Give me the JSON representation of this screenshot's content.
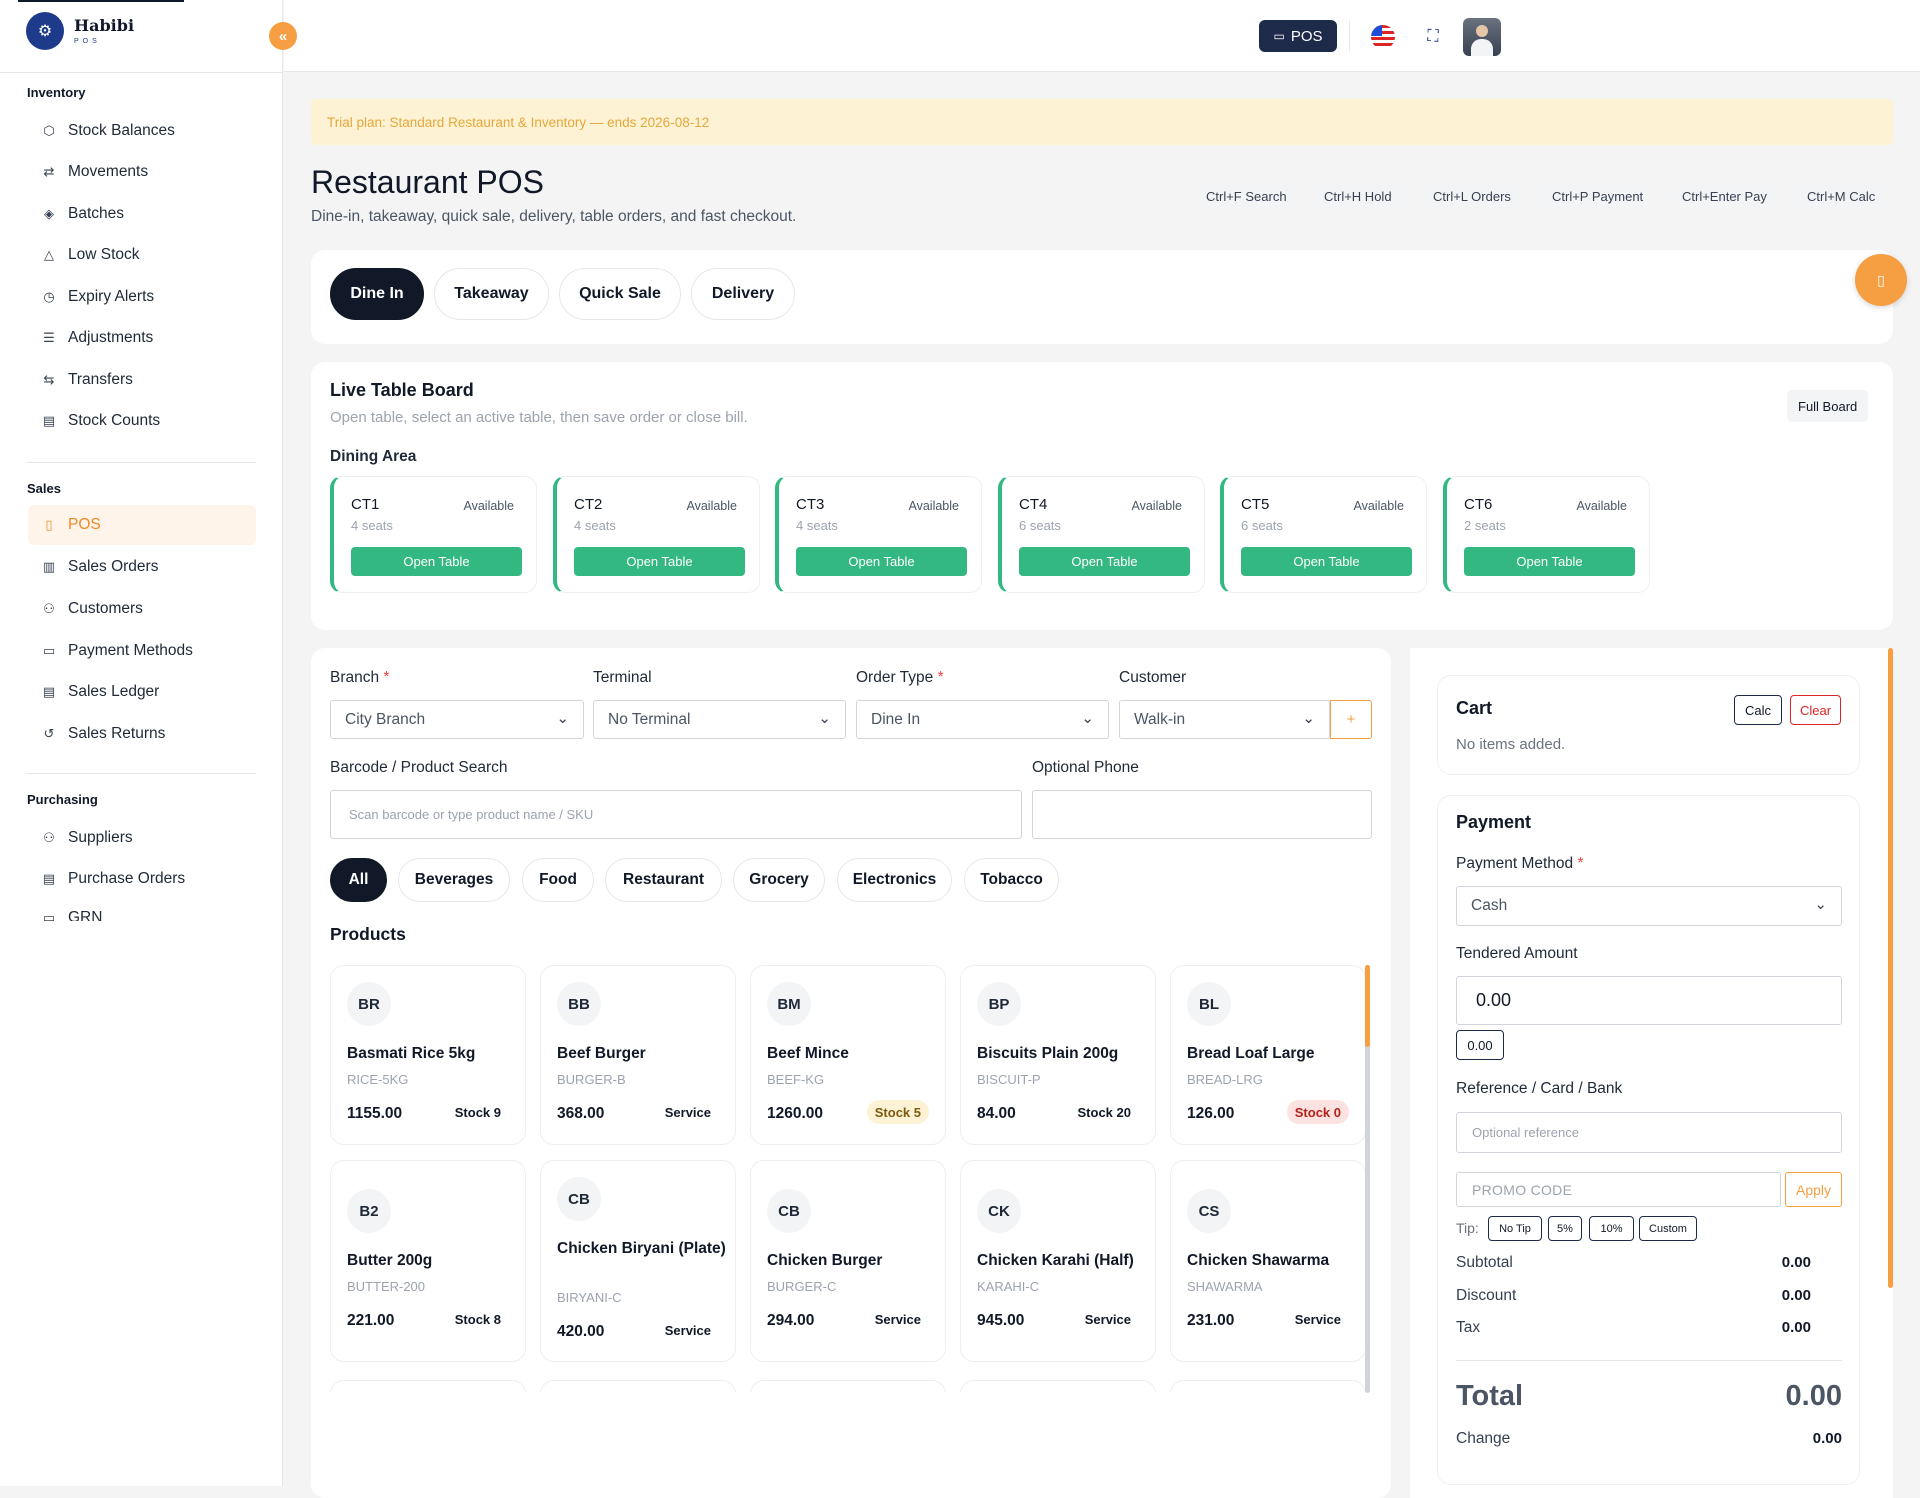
{
  "brand": {
    "name": "Habibi",
    "sub": "POS"
  },
  "sidebar": {
    "sections": [
      {
        "title": "Inventory",
        "items": [
          {
            "label": "Stock Balances",
            "icon": "cube-icon"
          },
          {
            "label": "Movements",
            "icon": "arrows-icon"
          },
          {
            "label": "Batches",
            "icon": "layers-icon"
          },
          {
            "label": "Low Stock",
            "icon": "warning-icon"
          },
          {
            "label": "Expiry Alerts",
            "icon": "clock-icon"
          },
          {
            "label": "Adjustments",
            "icon": "sliders-icon"
          },
          {
            "label": "Transfers",
            "icon": "transfer-icon"
          },
          {
            "label": "Stock Counts",
            "icon": "clipboard-icon"
          }
        ]
      },
      {
        "title": "Sales",
        "items": [
          {
            "label": "POS",
            "icon": "pos-icon",
            "active": true
          },
          {
            "label": "Sales Orders",
            "icon": "receipt-icon"
          },
          {
            "label": "Customers",
            "icon": "users-icon"
          },
          {
            "label": "Payment Methods",
            "icon": "card-icon"
          },
          {
            "label": "Sales Ledger",
            "icon": "ledger-icon"
          },
          {
            "label": "Sales Returns",
            "icon": "return-icon"
          }
        ]
      },
      {
        "title": "Purchasing",
        "items": [
          {
            "label": "Suppliers",
            "icon": "users-icon"
          },
          {
            "label": "Purchase Orders",
            "icon": "clipboard-icon"
          },
          {
            "label": "GRN",
            "icon": "doc-icon"
          }
        ]
      }
    ]
  },
  "topbar": {
    "pos_label": "POS"
  },
  "trial": "Trial plan: Standard Restaurant & Inventory — ends 2026-08-12",
  "page": {
    "title": "Restaurant POS",
    "subtitle": "Dine-in, takeaway, quick sale, delivery, table orders, and fast checkout."
  },
  "shortcuts": [
    "Ctrl+F Search",
    "Ctrl+H Hold",
    "Ctrl+L Orders",
    "Ctrl+P Payment",
    "Ctrl+Enter Pay",
    "Ctrl+M Calc"
  ],
  "order_tabs": [
    {
      "label": "Dine In",
      "selected": true
    },
    {
      "label": "Takeaway"
    },
    {
      "label": "Quick Sale"
    },
    {
      "label": "Delivery"
    }
  ],
  "table_board": {
    "title": "Live Table Board",
    "subtitle": "Open table, select an active table, then save order or close bill.",
    "full_board": "Full Board",
    "area": "Dining Area",
    "open_label": "Open Table",
    "tables": [
      {
        "name": "CT1",
        "seats": "4 seats",
        "status": "Available"
      },
      {
        "name": "CT2",
        "seats": "4 seats",
        "status": "Available"
      },
      {
        "name": "CT3",
        "seats": "4 seats",
        "status": "Available"
      },
      {
        "name": "CT4",
        "seats": "6 seats",
        "status": "Available"
      },
      {
        "name": "CT5",
        "seats": "6 seats",
        "status": "Available"
      },
      {
        "name": "CT6",
        "seats": "2 seats",
        "status": "Available"
      }
    ]
  },
  "form": {
    "branch_label": "Branch",
    "branch_value": "City Branch",
    "terminal_label": "Terminal",
    "terminal_value": "No Terminal",
    "ordertype_label": "Order Type",
    "ordertype_value": "Dine In",
    "customer_label": "Customer",
    "customer_value": "Walk-in",
    "add_label": "+",
    "search_label": "Barcode / Product Search",
    "search_placeholder": "Scan barcode or type product name / SKU",
    "phone_label": "Optional Phone",
    "phone_value": ""
  },
  "categories": [
    {
      "label": "All",
      "selected": true
    },
    {
      "label": "Beverages"
    },
    {
      "label": "Food"
    },
    {
      "label": "Restaurant"
    },
    {
      "label": "Grocery"
    },
    {
      "label": "Electronics"
    },
    {
      "label": "Tobacco"
    }
  ],
  "products_title": "Products",
  "products": [
    {
      "abbr": "BR",
      "name": "Basmati Rice 5kg",
      "sku": "RICE-5KG",
      "price": "1155.00",
      "stock": "Stock 9",
      "kind": "normal"
    },
    {
      "abbr": "BB",
      "name": "Beef Burger",
      "sku": "BURGER-B",
      "price": "368.00",
      "stock": "Service",
      "kind": "normal"
    },
    {
      "abbr": "BM",
      "name": "Beef Mince",
      "sku": "BEEF-KG",
      "price": "1260.00",
      "stock": "Stock 5",
      "kind": "warn"
    },
    {
      "abbr": "BP",
      "name": "Biscuits Plain 200g",
      "sku": "BISCUIT-P",
      "price": "84.00",
      "stock": "Stock 20",
      "kind": "normal"
    },
    {
      "abbr": "BL",
      "name": "Bread Loaf Large",
      "sku": "BREAD-LRG",
      "price": "126.00",
      "stock": "Stock 0",
      "kind": "zero"
    },
    {
      "abbr": "B2",
      "name": "Butter 200g",
      "sku": "BUTTER-200",
      "price": "221.00",
      "stock": "Stock 8",
      "kind": "normal"
    },
    {
      "abbr": "CB",
      "name": "Chicken Biryani (Plate)",
      "sku": "BIRYANI-C",
      "price": "420.00",
      "stock": "Service",
      "kind": "normal"
    },
    {
      "abbr": "CB",
      "name": "Chicken Burger",
      "sku": "BURGER-C",
      "price": "294.00",
      "stock": "Service",
      "kind": "normal"
    },
    {
      "abbr": "CK",
      "name": "Chicken Karahi (Half)",
      "sku": "KARAHI-C",
      "price": "945.00",
      "stock": "Service",
      "kind": "normal"
    },
    {
      "abbr": "CS",
      "name": "Chicken Shawarma",
      "sku": "SHAWARMA",
      "price": "231.00",
      "stock": "Service",
      "kind": "normal"
    }
  ],
  "cart": {
    "title": "Cart",
    "calc": "Calc",
    "clear": "Clear",
    "empty": "No items added."
  },
  "payment": {
    "title": "Payment",
    "method_label": "Payment Method",
    "method_value": "Cash",
    "tendered_label": "Tendered Amount",
    "tendered_value": "0.00",
    "quick": "0.00",
    "ref_label": "Reference / Card / Bank",
    "ref_placeholder": "Optional reference",
    "promo_placeholder": "PROMO CODE",
    "apply": "Apply",
    "tip_label": "Tip:",
    "tips": [
      "No Tip",
      "5%",
      "10%",
      "Custom"
    ],
    "subtotal_label": "Subtotal",
    "subtotal": "0.00",
    "discount_label": "Discount",
    "discount": "0.00",
    "tax_label": "Tax",
    "tax": "0.00",
    "total_label": "Total",
    "total": "0.00",
    "change_label": "Change",
    "change": "0.00"
  },
  "colors": {
    "accent": "#f59e42",
    "navy": "#111827",
    "green": "#34b882"
  }
}
